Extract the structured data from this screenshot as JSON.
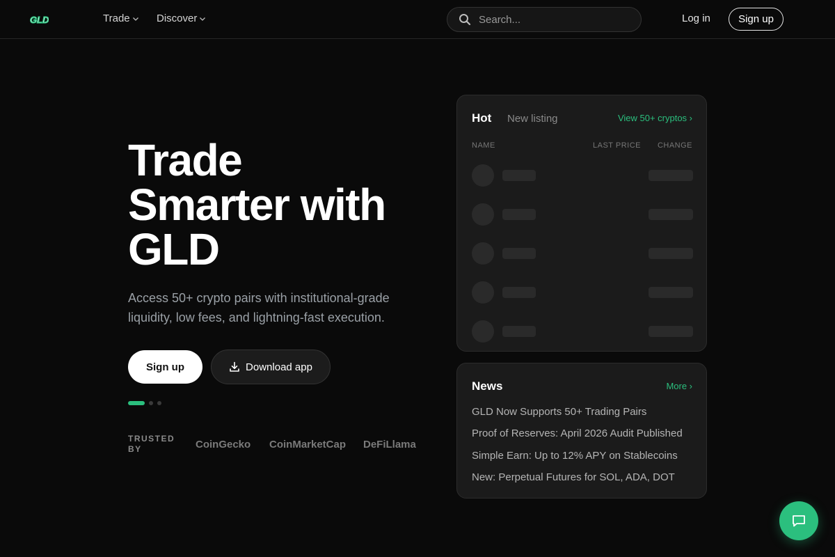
{
  "header": {
    "logo": "GLD",
    "nav": [
      {
        "label": "Trade"
      },
      {
        "label": "Discover"
      }
    ],
    "search_placeholder": "Search...",
    "login": "Log in",
    "signup": "Sign up"
  },
  "hero": {
    "title_lines": [
      "Trade",
      "Smarter with",
      "GLD"
    ],
    "subtitle": "Access 50+ crypto pairs with institutional-grade liquidity, low fees, and lightning-fast execution.",
    "signup": "Sign up",
    "download": "Download app",
    "carousel_active_index": 0,
    "carousel_count": 3,
    "trusted_label": "TRUSTED BY",
    "partners": [
      "CoinGecko",
      "CoinMarketCap",
      "DeFiLlama"
    ]
  },
  "markets": {
    "tabs": [
      "Hot",
      "New listing"
    ],
    "active_tab": "Hot",
    "view_all": "View 50+ cryptos ›",
    "columns": [
      "NAME",
      "LAST PRICE",
      "CHANGE"
    ],
    "loading_rows": 5
  },
  "news": {
    "title": "News",
    "more": "More ›",
    "items": [
      "GLD Now Supports 50+ Trading Pairs",
      "Proof of Reserves: April 2026 Audit Published",
      "Simple Earn: Up to 12% APY on Stablecoins",
      "New: Perpetual Futures for SOL, ADA, DOT"
    ]
  },
  "colors": {
    "accent": "#2bbf7e",
    "background": "#0a0a0a",
    "card": "#1b1b1b"
  },
  "icons": {
    "search": "search-icon",
    "download": "download-icon",
    "chat": "chat-bubble-icon",
    "chevron": "chevron-down-icon"
  }
}
